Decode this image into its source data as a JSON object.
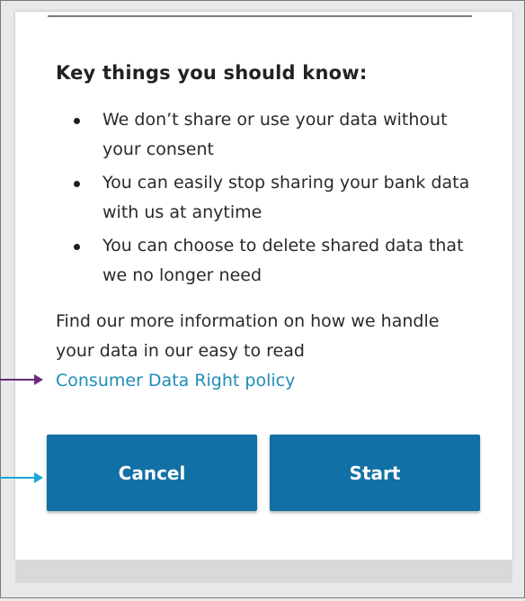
{
  "heading": "Key things you should know:",
  "key_points": [
    "We don’t share or use your data without your consent",
    "You can easily stop sharing your bank data with us at anytime",
    "You can choose to delete shared data that we no longer need"
  ],
  "info_text": "Find our more information on how we handle your data in our easy to read",
  "policy_link": "Consumer Data Right policy",
  "buttons": {
    "cancel": "Cancel",
    "start": "Start"
  },
  "colors": {
    "button": "#1170a6",
    "link": "#1f8db8",
    "arrow_purple": "#6a2a7a",
    "arrow_teal": "#1ba7d6"
  }
}
